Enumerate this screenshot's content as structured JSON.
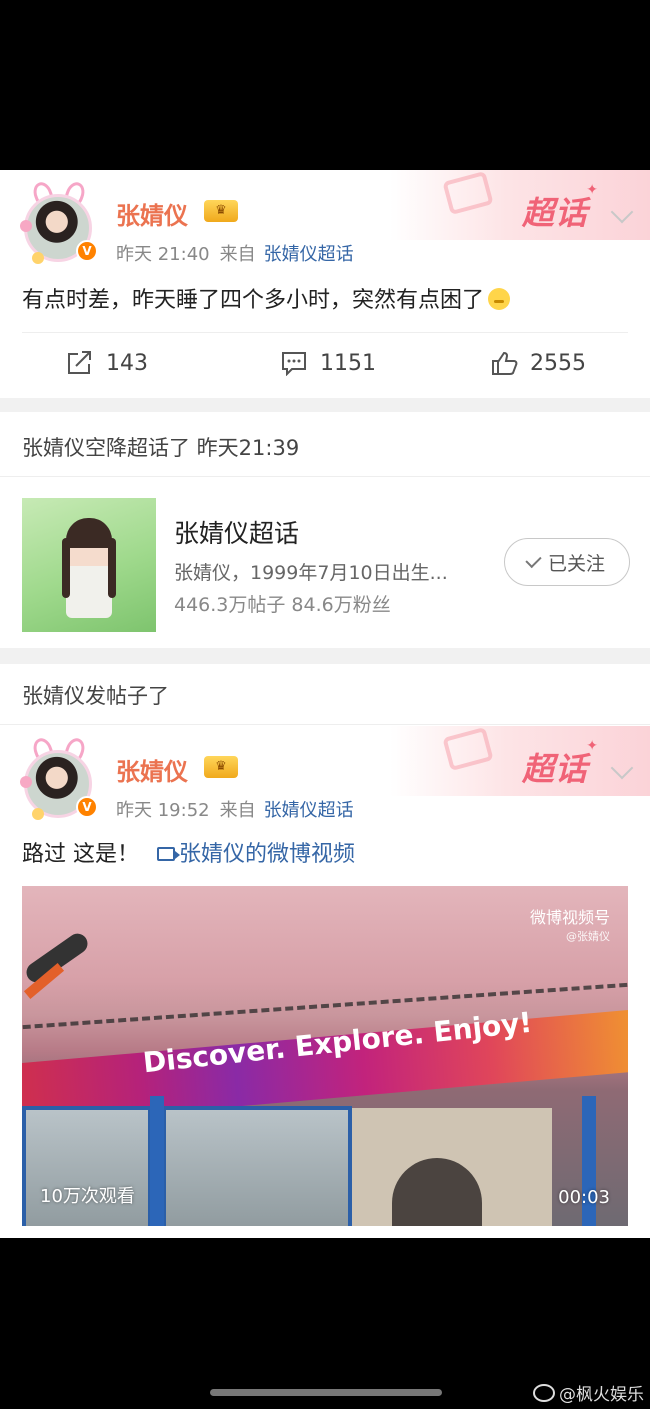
{
  "post1": {
    "username": "张婧仪",
    "crown_badge": "👑",
    "time": "昨天 21:40",
    "source_prefix": "来自",
    "source": "张婧仪超话",
    "super_label": "超话",
    "text": "有点时差，昨天睡了四个多小时，突然有点困了",
    "actions": {
      "repost": "143",
      "comment": "1151",
      "like": "2555"
    }
  },
  "topic_notice": {
    "title": "张婧仪空降超话了 昨天21:39"
  },
  "topic_card": {
    "name": "张婧仪超话",
    "desc": "张婧仪，1999年7月10日出生...",
    "stats": "446.3万帖子  84.6万粉丝",
    "follow_label": "已关注"
  },
  "post_notice": {
    "title": "张婧仪发帖子了"
  },
  "post2": {
    "username": "张婧仪",
    "crown_badge": "👑",
    "time": "昨天 19:52",
    "source_prefix": "来自",
    "source": "张婧仪超话",
    "super_label": "超话",
    "text": "路过 这是！",
    "video_link": "张婧仪的微博视频",
    "video": {
      "banner_text": "Discover. Explore. Enjoy!",
      "watermark": "微博视频号",
      "watermark_sub": "@张婧仪",
      "views": "10万次观看",
      "duration": "00:03"
    }
  },
  "footer": {
    "credit": "@枫火娱乐"
  },
  "colors": {
    "username": "#eb7350",
    "link": "#3566a6",
    "super": "#f06377",
    "vbadge": "#ff8200"
  }
}
